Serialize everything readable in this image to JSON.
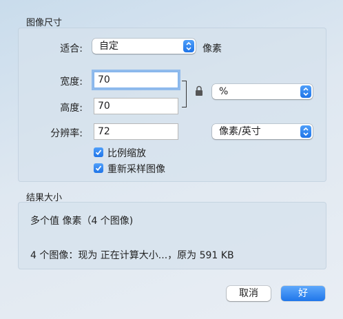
{
  "image_size": {
    "section_title": "图像尺寸",
    "fit_label": "适合:",
    "fit_value": "自定",
    "fit_unit": "像素",
    "width_label": "宽度:",
    "width_value": "70",
    "height_label": "高度:",
    "height_value": "70",
    "size_unit": "%",
    "resolution_label": "分辨率:",
    "resolution_value": "72",
    "resolution_unit": "像素/英寸",
    "scale_proportionally": {
      "label": "比例缩放",
      "checked": true
    },
    "resample_image": {
      "label": "重新采样图像",
      "checked": true
    }
  },
  "result_size": {
    "section_title": "结果大小",
    "multiple_values": "多个值 像素（4 个图像)",
    "summary": "4 个图像：现为 正在计算大小...，原为 591 KB"
  },
  "buttons": {
    "cancel": "取消",
    "ok": "好"
  },
  "colors": {
    "accent": "#1f74e8"
  }
}
